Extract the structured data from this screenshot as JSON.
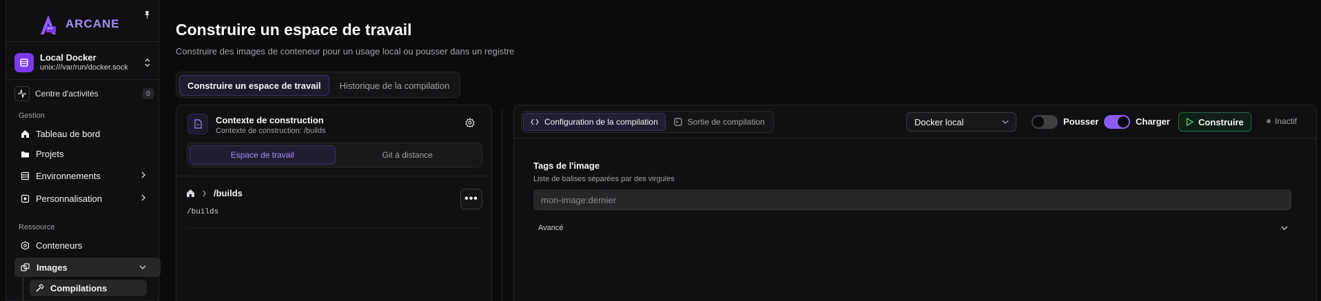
{
  "brand": {
    "name": "ARCANE"
  },
  "environment": {
    "name": "Local Docker",
    "socket": "unix:///var/run/docker.sock"
  },
  "activity": {
    "label": "Centre d'activités",
    "count": "0"
  },
  "sidebar": {
    "group_management": "Gestion",
    "dashboard": "Tableau de bord",
    "projects": "Projets",
    "environments": "Environnements",
    "customization": "Personnalisation",
    "group_resource": "Ressource",
    "containers": "Conteneurs",
    "images": "Images",
    "builds": "Compilations"
  },
  "page": {
    "title": "Construire un espace de travail",
    "subtitle": "Construire des images de conteneur pour un usage local ou pousser dans un registre"
  },
  "tabs": [
    {
      "label": "Construire un espace de travail",
      "active": true
    },
    {
      "label": "Historique de la compilation",
      "active": false
    }
  ],
  "context": {
    "title": "Contexte de construction",
    "subtitle": "Contexte de construction: /builds",
    "source_workspace": "Espace de travail",
    "source_git": "Git à distance",
    "path": "/builds",
    "path_mono": "/builds",
    "more": "•••"
  },
  "config": {
    "tab_config": "Configuration de la compilation",
    "tab_output": "Sortie de compilation",
    "target": "Docker local",
    "push_label": "Pousser",
    "push_on": false,
    "load_label": "Charger",
    "load_on": true,
    "build_label": "Construire",
    "status": "Inactif",
    "tags_title": "Tags de l'image",
    "tags_hint": "Liste de balises séparées par des virgules",
    "tags_placeholder": "mon-image:dernier",
    "advanced": "Avancé"
  },
  "colors": {
    "accent": "#8b5cf6",
    "brand": "#a78bfa",
    "success_border": "#1f6f45",
    "background": "#0b0b0c"
  }
}
